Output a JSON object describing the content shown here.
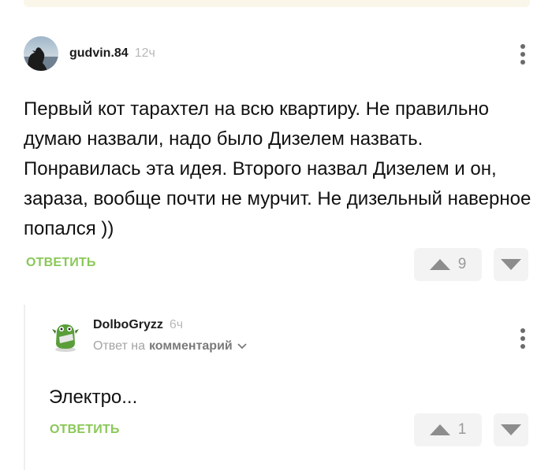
{
  "comment": {
    "username": "gudvin.84",
    "time": "12ч",
    "text": "Первый кот тарахтел на всю квартиру. Не правильно думаю назвали, надо было Дизелем назвать. Понравилась эта идея. Второго назвал Дизелем и он, зараза, вообще почти не мурчит. Не дизельный наверное попался ))",
    "reply_label": "ОТВЕТИТЬ",
    "rating": "9",
    "avatar_icon": "dog-avatar"
  },
  "reply": {
    "username": "DolboGryzz",
    "time": "6ч",
    "reply_to_prefix": "Ответ на",
    "reply_to_link": "комментарий",
    "text": "Электро...",
    "reply_label": "ОТВЕТИТЬ",
    "rating": "1",
    "avatar_icon": "green-creature-avatar"
  },
  "colors": {
    "accent_green": "#8ac858",
    "muted_gray": "#9a9a9a",
    "pill_bg": "#f3f3f3"
  }
}
